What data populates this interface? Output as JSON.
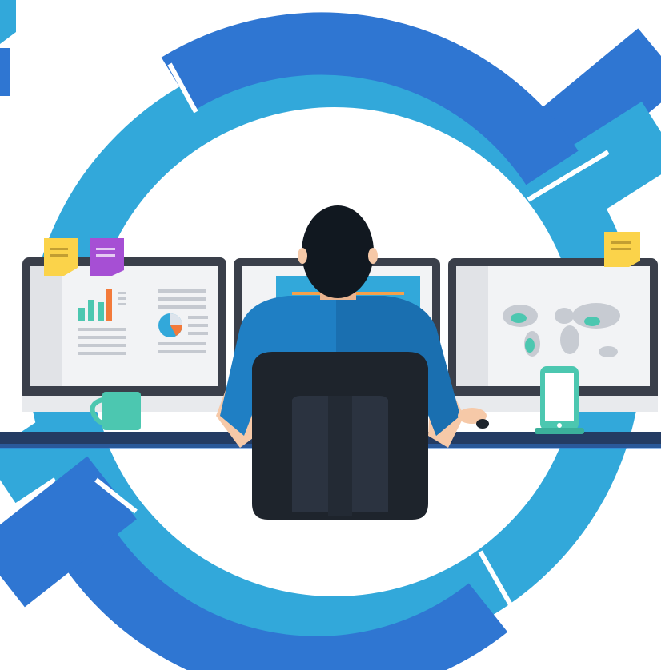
{
  "illustration": {
    "subject": "person-at-desk-with-three-monitors",
    "icons": [
      "analytics-dashboard-icon",
      "pie-chart-icon",
      "world-map-icon",
      "smartphone-icon",
      "coffee-mug-icon",
      "sticky-note-icon",
      "office-chair-icon"
    ]
  },
  "colors": {
    "ring_dark_blue": "#2F76D2",
    "ring_light_blue": "#32A8DA",
    "background": "#FFFFFF",
    "monitor_frame": "#3A3F4A",
    "screen": "#F2F3F5",
    "shirt": "#1F7FC4",
    "hair": "#111820",
    "skin": "#F6C9A8",
    "chair": "#1E242C",
    "teal": "#4CC7B0",
    "orange": "#F37A3A",
    "yellow_note": "#FBD34A",
    "purple_note": "#A64FD4"
  }
}
